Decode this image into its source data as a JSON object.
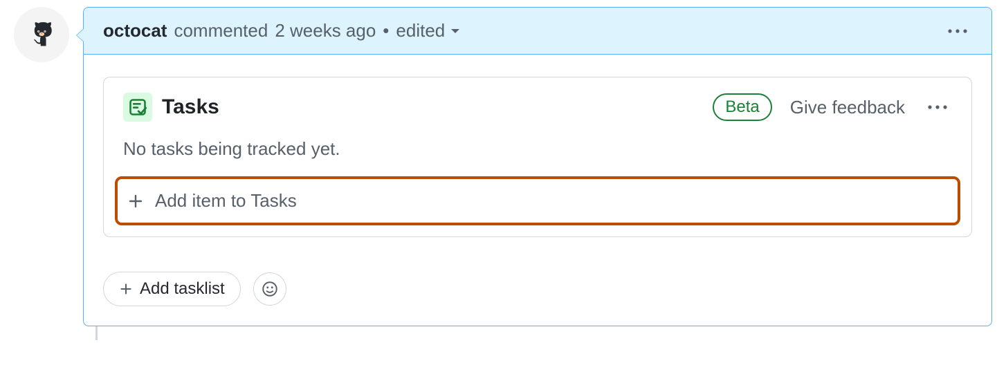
{
  "comment": {
    "author": "octocat",
    "action": "commented",
    "timestamp": "2 weeks ago",
    "separator": "•",
    "edited_label": "edited"
  },
  "tasks_panel": {
    "title": "Tasks",
    "badge": "Beta",
    "feedback": "Give feedback",
    "empty_state": "No tasks being tracked yet.",
    "add_item_label": "Add item to Tasks"
  },
  "footer": {
    "add_tasklist": "Add tasklist"
  }
}
